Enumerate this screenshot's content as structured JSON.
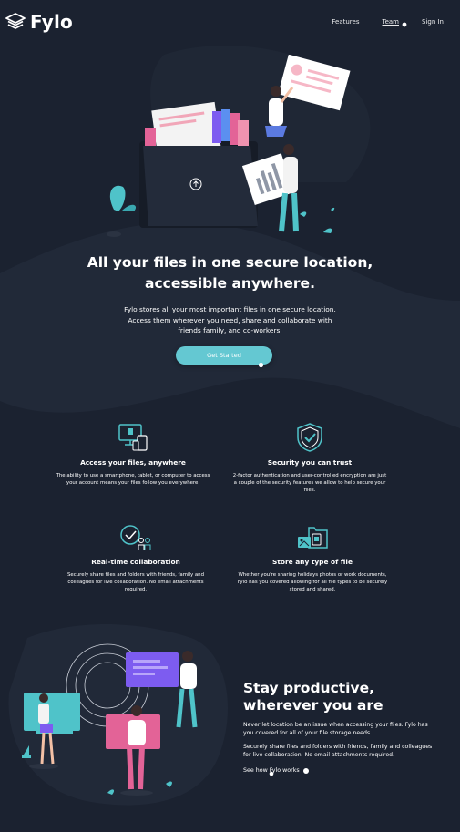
{
  "brand": {
    "name": "Fylo"
  },
  "nav": {
    "items": [
      {
        "label": "Features",
        "active": false
      },
      {
        "label": "Team",
        "active": true
      },
      {
        "label": "Sign In",
        "active": false
      }
    ]
  },
  "hero": {
    "title_line1": "All your files in one secure location,",
    "title_line2": "accessible anywhere.",
    "text_line1": "Fylo stores all your most important files in one secure location.",
    "text_line2": "Access them wherever you need, share and collaborate with",
    "text_line3": "friends family, and co-workers.",
    "cta_label": "Get Started"
  },
  "features": [
    {
      "title": "Access your files, anywhere",
      "text": "The ability to use a smartphone, tablet, or computer to access your account means your files follow you everywhere.",
      "icon": "access-anywhere-icon"
    },
    {
      "title": "Security you can trust",
      "text": "2-factor authentication and user-controlled encryption are just a couple of the security features we allow to help secure your files.",
      "icon": "security-shield-icon"
    },
    {
      "title": "Real-time collaboration",
      "text": "Securely share files and folders with friends, family and colleagues for live collaboration. No email attachments required.",
      "icon": "collaboration-icon"
    },
    {
      "title": "Store any type of file",
      "text": "Whether you're sharing holidays photos or work documents, Fylo has you covered allowing for all file types to be securely stored and shared.",
      "icon": "any-file-icon"
    }
  ],
  "productive": {
    "title_line1": "Stay productive,",
    "title_line2": "wherever you are",
    "paragraph1": "Never let location be an issue when accessing your files. Fylo has you covered for all of your file storage needs.",
    "paragraph2": "Securely share files and folders with friends, family and colleagues for live collaboration. No email attachments required.",
    "link_label": "See how Fylo works"
  },
  "colors": {
    "background": "#1b2230",
    "background_curve": "#212938",
    "accent_cyan": "#64c8d2",
    "accent_pink": "#e36397",
    "accent_purple": "#8a5cf5"
  }
}
